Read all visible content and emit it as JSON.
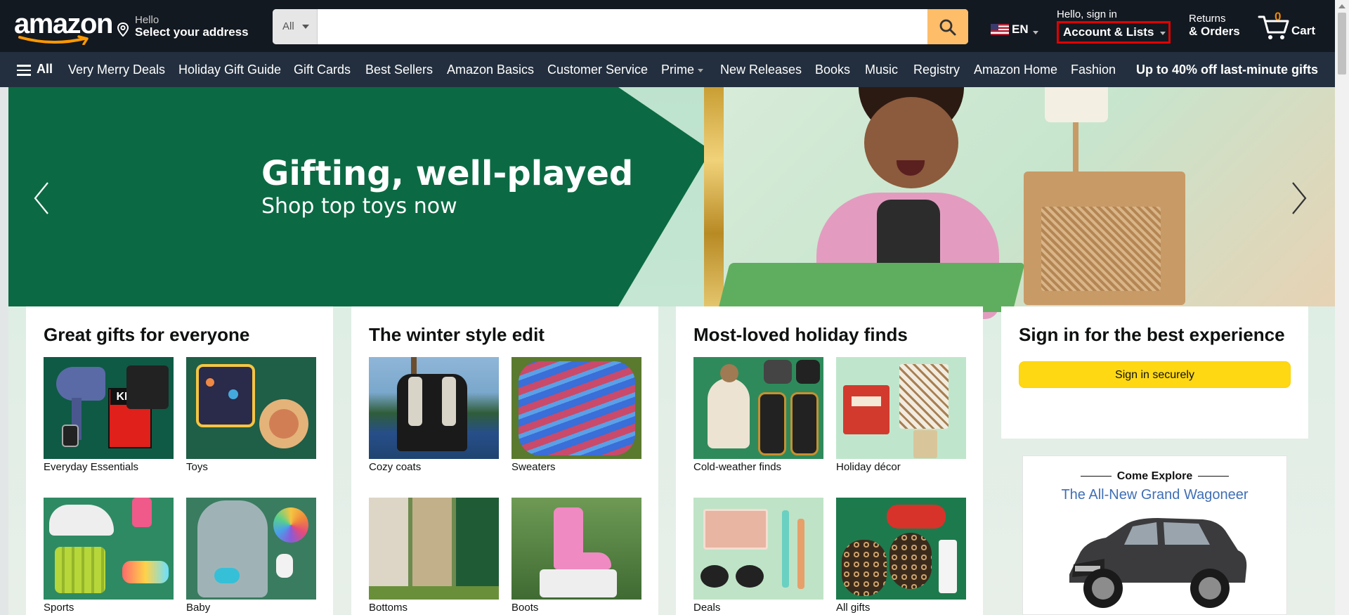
{
  "header": {
    "logo_text": "amazon",
    "address": {
      "greeting": "Hello",
      "prompt": "Select your address"
    },
    "search": {
      "category": "All",
      "value": "",
      "placeholder": ""
    },
    "language": {
      "code": "EN"
    },
    "account": {
      "greeting": "Hello, sign in",
      "label": "Account & Lists"
    },
    "returns": {
      "line1": "Returns",
      "line2": "& Orders"
    },
    "cart": {
      "count": "0",
      "label": "Cart"
    }
  },
  "subnav": {
    "all_label": "All",
    "items": [
      "Very Merry Deals",
      "Holiday Gift Guide",
      "Gift Cards",
      "Best Sellers",
      "Amazon Basics",
      "Customer Service",
      "Prime",
      "New Releases",
      "Books",
      "Music",
      "Registry",
      "Amazon Home",
      "Fashion"
    ],
    "promo": "Up to 40% off last-minute gifts"
  },
  "hero": {
    "title": "Gifting, well-played",
    "subtitle": "Shop top toys now"
  },
  "cards": [
    {
      "title": "Great gifts for everyone",
      "tiles": [
        {
          "label": "Everyday Essentials",
          "bg": "#0e5a45"
        },
        {
          "label": "Toys",
          "bg": "#1f5e47"
        },
        {
          "label": "Sports",
          "bg": "#2e8a63"
        },
        {
          "label": "Baby",
          "bg": "#3a7c60"
        }
      ]
    },
    {
      "title": "The winter style edit",
      "tiles": [
        {
          "label": "Cozy coats",
          "bg": "#4f7ea8"
        },
        {
          "label": "Sweaters",
          "bg": "#c6532f"
        },
        {
          "label": "Bottoms",
          "bg": "#6d8a4f"
        },
        {
          "label": "Boots",
          "bg": "#4d7a3e"
        }
      ]
    },
    {
      "title": "Most-loved holiday finds",
      "tiles": [
        {
          "label": "Cold-weather finds",
          "bg": "#2f8a5b"
        },
        {
          "label": "Holiday décor",
          "bg": "#bfe6cc"
        },
        {
          "label": "Deals",
          "bg": "#bfe3c6"
        },
        {
          "label": "All gifts",
          "bg": "#1d7a4d"
        }
      ]
    }
  ],
  "signin": {
    "title": "Sign in for the best experience",
    "button": "Sign in securely"
  },
  "ad": {
    "kicker": "Come Explore",
    "headline": "The All-New Grand Wagoneer"
  },
  "colors": {
    "nav_bg": "#131921",
    "subnav_bg": "#232f3e",
    "search_button": "#febd69",
    "cart_count": "#f08804",
    "hero_green": "#0b6a43",
    "signin_button": "#ffd814",
    "account_outline": "#e00000"
  }
}
